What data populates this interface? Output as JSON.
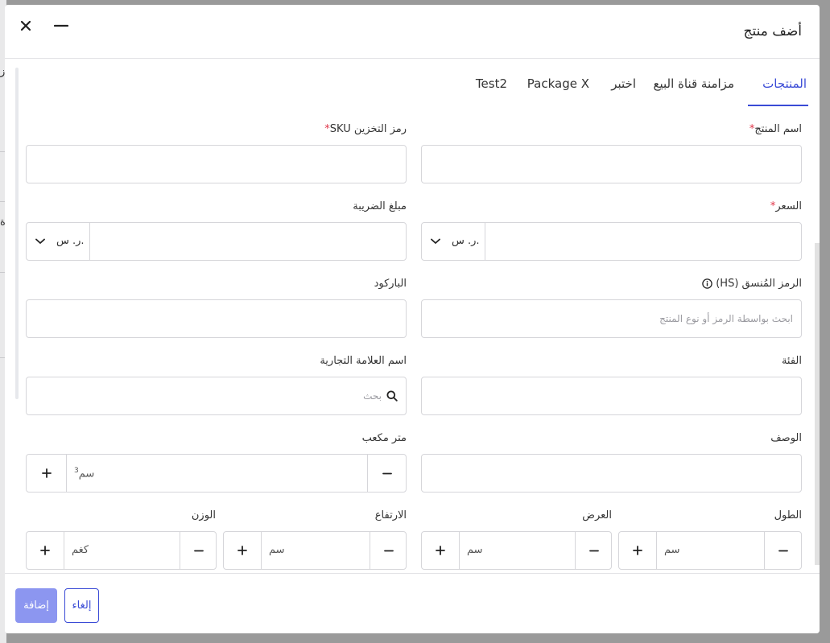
{
  "modal": {
    "title": "أضف منتج"
  },
  "tabs": [
    {
      "label": "المنتجات",
      "active": true
    },
    {
      "label": "مزامنة قناة البيع"
    },
    {
      "label": "اختبر"
    },
    {
      "label": "Package X"
    },
    {
      "label": "Test2"
    }
  ],
  "form": {
    "product_name": {
      "label": "اسم المنتج",
      "required_mark": "*",
      "value": ""
    },
    "sku": {
      "label": "رمز التخزين SKU",
      "required_mark": "*",
      "value": ""
    },
    "price": {
      "label": "السعر",
      "required_mark": "*",
      "value": "",
      "currency": "ر. س."
    },
    "tax_amount": {
      "label": "مبلغ الضريبة",
      "value": "",
      "currency": "ر. س."
    },
    "hs_code": {
      "label": "الرمز المُنسق (HS)",
      "placeholder": "ابحث بواسطة الرمز أو نوع المنتج"
    },
    "barcode": {
      "label": "الباركود",
      "value": ""
    },
    "category": {
      "label": "الفئة",
      "value": ""
    },
    "brand": {
      "label": "اسم العلامة التجارية",
      "placeholder": "بحث"
    },
    "description": {
      "label": "الوصف",
      "value": ""
    },
    "cubic_meter": {
      "label": "متر مكعب",
      "unit": "سم",
      "unit_sup": "3"
    },
    "length": {
      "label": "الطول",
      "unit": "سم"
    },
    "width": {
      "label": "العرض",
      "unit": "سم"
    },
    "height": {
      "label": "الارتفاع",
      "unit": "سم"
    },
    "weight": {
      "label": "الوزن",
      "unit": "كغم"
    }
  },
  "footer": {
    "add_label": "إضافة",
    "cancel_label": "إلغاء"
  },
  "backdrop": {
    "chars": [
      "ز",
      "ة"
    ]
  },
  "colors": {
    "accent": "#3a4bd6",
    "required": "#e0364a",
    "add_button_disabled": "#8c96f0"
  }
}
